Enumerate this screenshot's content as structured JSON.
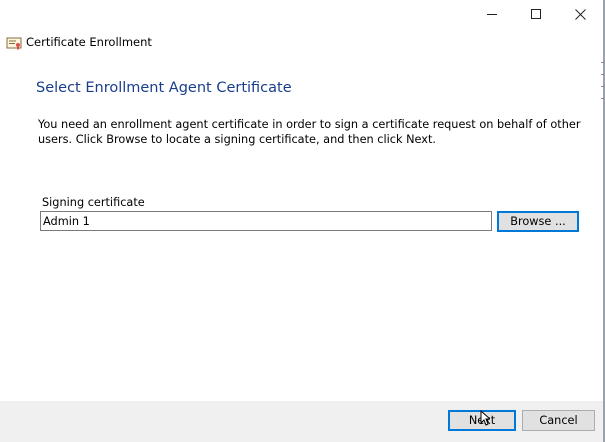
{
  "window": {
    "title": "Certificate Enrollment",
    "icon": "certificate-icon",
    "caption_buttons": [
      "minimize-icon",
      "maximize-icon",
      "close-icon"
    ]
  },
  "page": {
    "heading": "Select Enrollment Agent Certificate",
    "description": "You need an enrollment agent certificate in order to sign a certificate request on behalf of other users. Click Browse to locate a signing certificate, and then click Next."
  },
  "signing_certificate": {
    "label": "Signing certificate",
    "value": "Admin 1",
    "browse_label": "Browse ..."
  },
  "footer": {
    "next_label": "Next",
    "cancel_label": "Cancel"
  },
  "colors": {
    "heading": "#1a3e8c",
    "focus_border": "#0078d7",
    "footer_bg": "#f0f0f0",
    "button_bg": "#e1e1e1"
  }
}
